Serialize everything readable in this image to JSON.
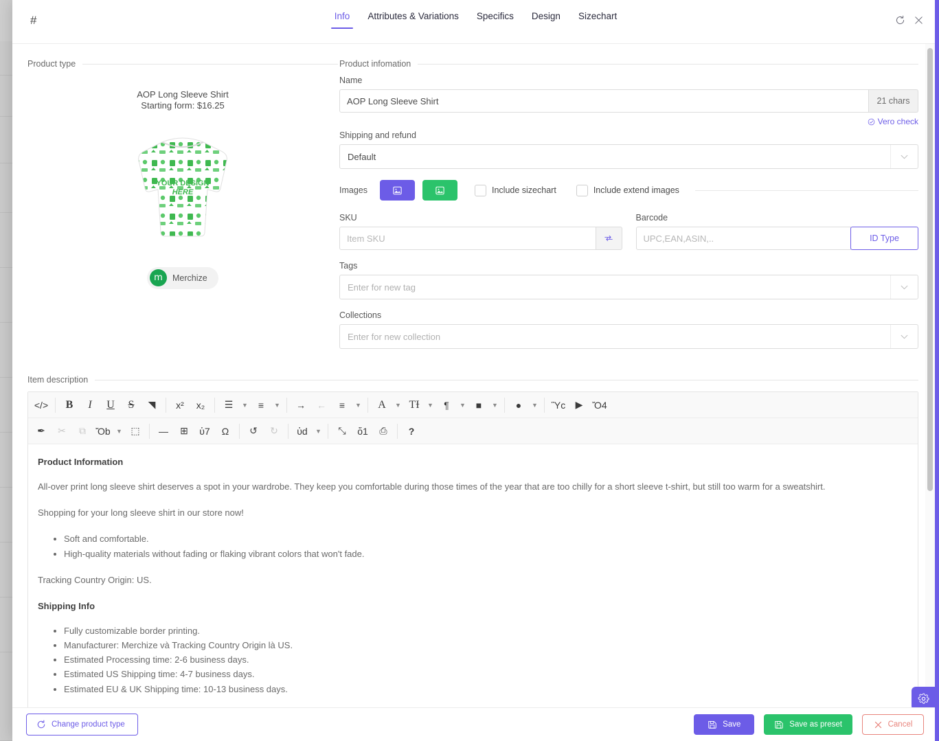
{
  "header": {
    "hash_label": "#",
    "tabs": [
      {
        "label": "Info",
        "active": true
      },
      {
        "label": "Attributes & Variations",
        "active": false
      },
      {
        "label": "Specifics",
        "active": false
      },
      {
        "label": "Design",
        "active": false
      },
      {
        "label": "Sizechart",
        "active": false
      }
    ],
    "refresh_icon": "refresh-icon",
    "close_icon": "close-icon"
  },
  "product_type": {
    "legend": "Product type",
    "name": "AOP Long Sleeve Shirt",
    "price_line": "Starting form: $16.25",
    "vendor": "Merchize",
    "vendor_initial": "m",
    "design_text_1": "YOUR DESIGN",
    "design_text_2": "HERE"
  },
  "product_info": {
    "legend": "Product infomation",
    "name_label": "Name",
    "name_value": "AOP Long Sleeve Shirt",
    "char_count": "21 chars",
    "vero_check": "Vero check",
    "shipping_label": "Shipping and refund",
    "shipping_value": "Default",
    "images_label": "Images",
    "include_sizechart": "Include sizechart",
    "include_extend_images": "Include extend images",
    "sku_label": "SKU",
    "sku_placeholder": "Item SKU",
    "sku_value": "",
    "barcode_label": "Barcode",
    "barcode_placeholder": "UPC,EAN,ASIN,..",
    "barcode_value": "",
    "id_type": "ID Type",
    "tags_label": "Tags",
    "tags_placeholder": "Enter for new tag",
    "collections_label": "Collections",
    "collections_placeholder": "Enter for new collection"
  },
  "description": {
    "legend": "Item description",
    "heading_1": "Product Information",
    "para_1": "All-over print long sleeve shirt deserves a spot in your wardrobe. They keep you comfortable during those times of the year that are too chilly for a short sleeve t-shirt, but still too warm for a sweatshirt.",
    "para_2": "Shopping for your long sleeve shirt in our store now!",
    "bullets_1": [
      "Soft and comfortable.",
      "High-quality materials without fading or flaking vibrant colors that won't fade."
    ],
    "para_3": "Tracking Country Origin: US.",
    "heading_2": "Shipping Info",
    "bullets_2": [
      "Fully customizable border printing.",
      "Manufacturer: Merchize và Tracking Country Origin là US.",
      "Estimated Processing time: 2-6 business days.",
      "Estimated US Shipping time: 4-7 business days.",
      "Estimated EU & UK Shipping time: 10-13 business days."
    ]
  },
  "toolbar": {
    "row1": [
      {
        "name": "source-code-icon",
        "glyph": "</>",
        "caret": false,
        "dim": false
      },
      {
        "sep": true
      },
      {
        "name": "bold-icon",
        "glyph": "B",
        "caret": false,
        "dim": false,
        "bold": true,
        "serif": true
      },
      {
        "name": "italic-icon",
        "glyph": "I",
        "caret": false,
        "dim": false,
        "italic": true,
        "serif": true
      },
      {
        "name": "underline-icon",
        "glyph": "U",
        "caret": false,
        "dim": false,
        "underline": true,
        "serif": true
      },
      {
        "name": "strikethrough-icon",
        "glyph": "S",
        "caret": false,
        "dim": false,
        "strike": true,
        "serif": true
      },
      {
        "name": "clear-format-icon",
        "glyph": "◥",
        "caret": false,
        "dim": false
      },
      {
        "sep": true
      },
      {
        "name": "superscript-icon",
        "glyph": "x²",
        "caret": false,
        "dim": false
      },
      {
        "name": "subscript-icon",
        "glyph": "x₂",
        "caret": false,
        "dim": false
      },
      {
        "sep": true
      },
      {
        "name": "bullet-list-icon",
        "glyph": "☰",
        "caret": true,
        "dim": false
      },
      {
        "name": "numbered-list-icon",
        "glyph": "≡",
        "caret": true,
        "dim": false
      },
      {
        "sep": true
      },
      {
        "name": "indent-increase-icon",
        "glyph": "→",
        "caret": false,
        "dim": false
      },
      {
        "name": "indent-decrease-icon",
        "glyph": "←",
        "caret": false,
        "dim": true
      },
      {
        "name": "align-icon",
        "glyph": "≡",
        "caret": true,
        "dim": false
      },
      {
        "sep": true
      },
      {
        "name": "font-family-icon",
        "glyph": "A",
        "caret": true,
        "dim": false,
        "serif": true
      },
      {
        "name": "font-size-icon",
        "glyph": "TƗ",
        "caret": true,
        "dim": false,
        "serif": true
      },
      {
        "name": "paragraph-style-icon",
        "glyph": "¶",
        "caret": true,
        "dim": false
      },
      {
        "name": "text-color-icon",
        "glyph": "■",
        "caret": true,
        "dim": false
      },
      {
        "sep": true
      },
      {
        "name": "highlight-color-icon",
        "glyph": "●",
        "caret": true,
        "dim": false
      },
      {
        "sep": true
      },
      {
        "name": "insert-image-icon",
        "glyph": "Ὓc",
        "caret": false,
        "dim": false
      },
      {
        "name": "insert-video-icon",
        "glyph": "▶",
        "caret": false,
        "dim": false
      },
      {
        "name": "insert-file-icon",
        "glyph": "Ὄ4",
        "caret": false,
        "dim": false
      }
    ],
    "row2": [
      {
        "name": "format-painter-icon",
        "glyph": "✒",
        "caret": false,
        "dim": false
      },
      {
        "name": "cut-icon",
        "glyph": "✂",
        "caret": false,
        "dim": true
      },
      {
        "name": "copy-icon",
        "glyph": "⧉",
        "caret": false,
        "dim": true
      },
      {
        "name": "paste-icon",
        "glyph": "Ὄb",
        "caret": true,
        "dim": false
      },
      {
        "name": "select-all-icon",
        "glyph": "⬚",
        "caret": false,
        "dim": false
      },
      {
        "sep": true
      },
      {
        "name": "horizontal-rule-icon",
        "glyph": "—",
        "caret": false,
        "dim": false
      },
      {
        "name": "insert-table-icon",
        "glyph": "⊞",
        "caret": false,
        "dim": false
      },
      {
        "name": "insert-link-icon",
        "glyph": "ὑ7",
        "caret": false,
        "dim": false
      },
      {
        "name": "special-character-icon",
        "glyph": "Ω",
        "caret": false,
        "dim": false
      },
      {
        "sep": true
      },
      {
        "name": "undo-icon",
        "glyph": "↺",
        "caret": false,
        "dim": false
      },
      {
        "name": "redo-icon",
        "glyph": "↻",
        "caret": false,
        "dim": true
      },
      {
        "sep": true
      },
      {
        "name": "search-replace-icon",
        "glyph": "ὐd",
        "caret": true,
        "dim": false
      },
      {
        "sep": true
      },
      {
        "name": "fullscreen-icon",
        "glyph": "⤡",
        "caret": false,
        "dim": false
      },
      {
        "name": "preview-icon",
        "glyph": "ὄ1",
        "caret": false,
        "dim": false
      },
      {
        "name": "print-icon",
        "glyph": "⎙",
        "caret": false,
        "dim": false
      },
      {
        "sep": true
      },
      {
        "name": "help-icon",
        "glyph": "?",
        "caret": false,
        "dim": false,
        "bold": true
      }
    ]
  },
  "footer": {
    "change_product_type": "Change product type",
    "save": "Save",
    "save_as_preset": "Save as preset",
    "cancel": "Cancel"
  },
  "colors": {
    "accent_purple": "#6C5CE7",
    "accent_green": "#2BC36B",
    "cancel_red": "#e8847c",
    "vendor_green": "#19a551"
  },
  "gear_tab": {
    "icon": "gear-icon"
  }
}
